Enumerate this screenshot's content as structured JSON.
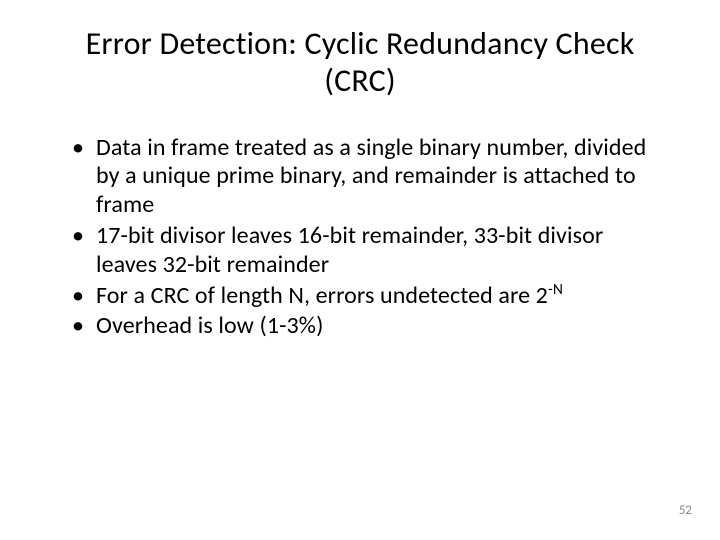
{
  "title": "Error Detection: Cyclic Redundancy Check (CRC)",
  "bullets": [
    "Data in frame treated as a single binary number, divided by a unique prime binary, and remainder is attached to frame",
    "17-bit divisor leaves 16-bit remainder, 33-bit divisor leaves 32-bit remainder",
    "For a CRC of length N, errors undetected are 2",
    "Overhead is low (1-3%)"
  ],
  "bullet3_superscript": "-N",
  "page_number": "52"
}
